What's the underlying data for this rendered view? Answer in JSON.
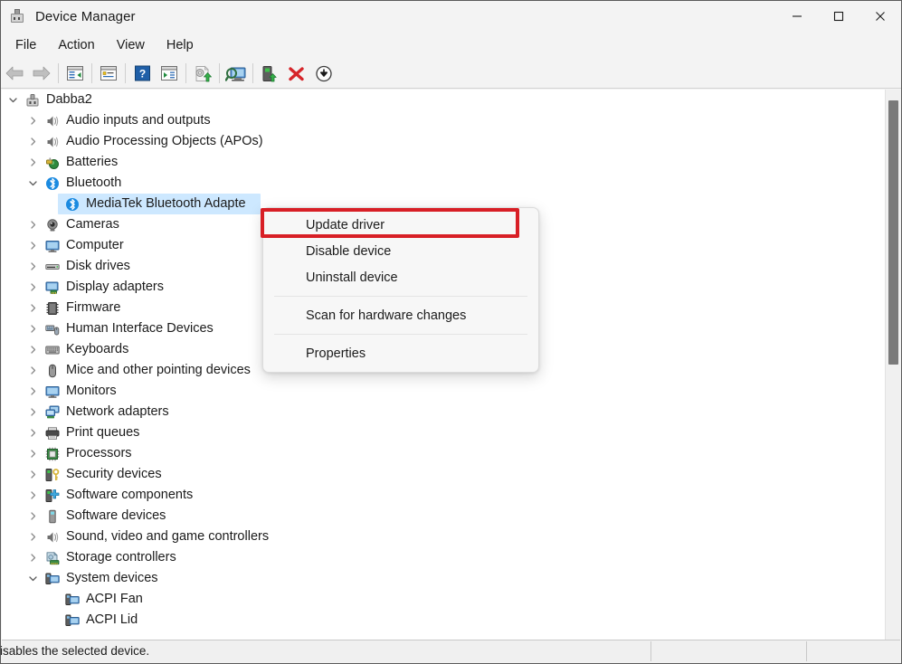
{
  "window": {
    "title": "Device Manager",
    "app_icon": "device-manager-icon",
    "caption": {
      "minimize": "minimize-icon",
      "maximize": "maximize-icon",
      "close": "close-icon"
    }
  },
  "menubar": {
    "items": [
      {
        "label": "File"
      },
      {
        "label": "Action"
      },
      {
        "label": "View"
      },
      {
        "label": "Help"
      }
    ]
  },
  "toolbar": {
    "buttons": [
      {
        "name": "back-icon",
        "title": "Back"
      },
      {
        "name": "forward-icon",
        "title": "Forward"
      },
      {
        "name": "show-hide-console-tree-icon",
        "title": "Show/Hide Console Tree"
      },
      {
        "name": "properties-icon",
        "title": "Properties"
      },
      {
        "name": "help-icon",
        "title": "Help"
      },
      {
        "name": "show-hide-action-pane-icon",
        "title": "Show/Hide Action Pane"
      },
      {
        "name": "update-driver-icon",
        "title": "Update driver"
      },
      {
        "name": "scan-for-hardware-changes-icon",
        "title": "Scan for hardware changes"
      },
      {
        "name": "enable-device-icon",
        "title": "Enable device"
      },
      {
        "name": "uninstall-device-icon",
        "title": "Uninstall device"
      },
      {
        "name": "disable-device-icon",
        "title": "Disable device"
      }
    ]
  },
  "tree": {
    "nodes": [
      {
        "label": "Dabba2",
        "indent": 0,
        "state": "expanded",
        "icon": "computer-root-icon",
        "selected": false
      },
      {
        "label": "Audio inputs and outputs",
        "indent": 1,
        "state": "collapsed",
        "icon": "speaker-icon",
        "selected": false
      },
      {
        "label": "Audio Processing Objects (APOs)",
        "indent": 1,
        "state": "collapsed",
        "icon": "speaker-icon",
        "selected": false
      },
      {
        "label": "Batteries",
        "indent": 1,
        "state": "collapsed",
        "icon": "battery-icon",
        "selected": false
      },
      {
        "label": "Bluetooth",
        "indent": 1,
        "state": "expanded",
        "icon": "bluetooth-icon",
        "selected": false
      },
      {
        "label": "MediaTek Bluetooth Adapte",
        "indent": 2,
        "state": "leaf",
        "icon": "bluetooth-icon",
        "selected": true
      },
      {
        "label": "Cameras",
        "indent": 1,
        "state": "collapsed",
        "icon": "camera-icon",
        "selected": false
      },
      {
        "label": "Computer",
        "indent": 1,
        "state": "collapsed",
        "icon": "monitor-icon",
        "selected": false
      },
      {
        "label": "Disk drives",
        "indent": 1,
        "state": "collapsed",
        "icon": "disk-drive-icon",
        "selected": false
      },
      {
        "label": "Display adapters",
        "indent": 1,
        "state": "collapsed",
        "icon": "display-adapter-icon",
        "selected": false
      },
      {
        "label": "Firmware",
        "indent": 1,
        "state": "collapsed",
        "icon": "firmware-chip-icon",
        "selected": false
      },
      {
        "label": "Human Interface Devices",
        "indent": 1,
        "state": "collapsed",
        "icon": "hid-icon",
        "selected": false
      },
      {
        "label": "Keyboards",
        "indent": 1,
        "state": "collapsed",
        "icon": "keyboard-icon",
        "selected": false
      },
      {
        "label": "Mice and other pointing devices",
        "indent": 1,
        "state": "collapsed",
        "icon": "mouse-icon",
        "selected": false
      },
      {
        "label": "Monitors",
        "indent": 1,
        "state": "collapsed",
        "icon": "monitor-icon",
        "selected": false
      },
      {
        "label": "Network adapters",
        "indent": 1,
        "state": "collapsed",
        "icon": "network-adapter-icon",
        "selected": false
      },
      {
        "label": "Print queues",
        "indent": 1,
        "state": "collapsed",
        "icon": "printer-icon",
        "selected": false
      },
      {
        "label": "Processors",
        "indent": 1,
        "state": "collapsed",
        "icon": "processor-icon",
        "selected": false
      },
      {
        "label": "Security devices",
        "indent": 1,
        "state": "collapsed",
        "icon": "security-key-icon",
        "selected": false
      },
      {
        "label": "Software components",
        "indent": 1,
        "state": "collapsed",
        "icon": "software-component-icon",
        "selected": false
      },
      {
        "label": "Software devices",
        "indent": 1,
        "state": "collapsed",
        "icon": "software-device-icon",
        "selected": false
      },
      {
        "label": "Sound, video and game controllers",
        "indent": 1,
        "state": "collapsed",
        "icon": "speaker-icon",
        "selected": false
      },
      {
        "label": "Storage controllers",
        "indent": 1,
        "state": "collapsed",
        "icon": "storage-controller-icon",
        "selected": false
      },
      {
        "label": "System devices",
        "indent": 1,
        "state": "expanded",
        "icon": "system-device-icon",
        "selected": false
      },
      {
        "label": "ACPI Fan",
        "indent": 2,
        "state": "leaf",
        "icon": "system-device-icon",
        "selected": false
      },
      {
        "label": "ACPI Lid",
        "indent": 2,
        "state": "leaf",
        "icon": "system-device-icon",
        "selected": false
      }
    ]
  },
  "context_menu": {
    "items": [
      {
        "label": "Update driver",
        "highlighted": true
      },
      {
        "label": "Disable device",
        "highlighted": false
      },
      {
        "label": "Uninstall device",
        "highlighted": false
      },
      {
        "separator": true
      },
      {
        "label": "Scan for hardware changes",
        "highlighted": false
      },
      {
        "separator": true
      },
      {
        "label": "Properties",
        "highlighted": false
      }
    ],
    "highlight_color": "#d81f26"
  },
  "statusbar": {
    "text": "isables the selected device."
  },
  "colors": {
    "selection": "#cde8ff",
    "highlight_red": "#d81f26",
    "chrome": "#f3f3f3"
  }
}
